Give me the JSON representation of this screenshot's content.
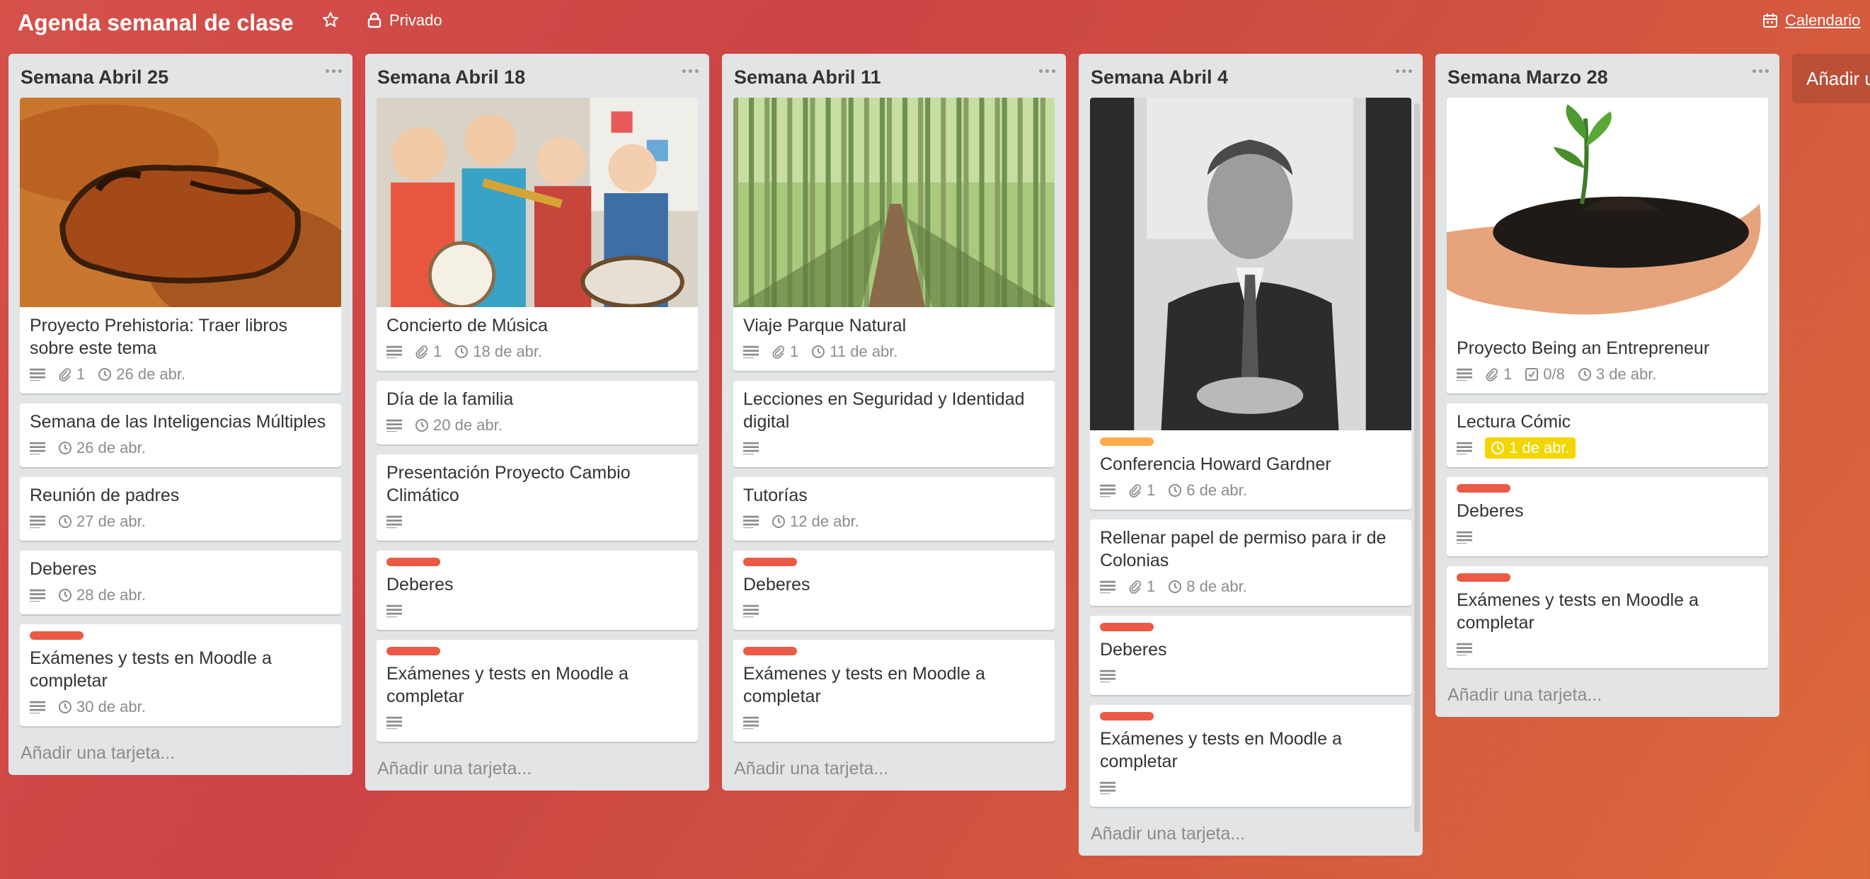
{
  "board": {
    "title": "Agenda semanal de clase",
    "visibility": "Privado",
    "calendar": "Calendario",
    "add_list": "Añadir u"
  },
  "colors": {
    "background": "#cb4445",
    "label_red": "#eb5a46",
    "label_orange": "#ffab4a",
    "due_yellow": "#f2d600"
  },
  "lists": [
    {
      "title": "Semana Abril 25",
      "add_card": "Añadir una tarjeta...",
      "cards": [
        {
          "cover": "cave-painting-bison",
          "title": "Proyecto Prehistoria: Traer libros sobre este tema",
          "attachments": "1",
          "due": "26 de abr."
        },
        {
          "title": "Semana de las Inteligencias Múltiples",
          "due": "26 de abr."
        },
        {
          "title": "Reunión de padres",
          "due": "27 de abr."
        },
        {
          "title": "Deberes",
          "due": "28 de abr."
        },
        {
          "label": "red",
          "title": "Exámenes y tests en Moodle a completar",
          "due": "30 de abr."
        }
      ]
    },
    {
      "title": "Semana Abril 18",
      "add_card": "Añadir una tarjeta...",
      "cards": [
        {
          "cover": "children-music-band",
          "title": "Concierto de Música",
          "attachments": "1",
          "due": "18 de abr."
        },
        {
          "title": "Día de la familia",
          "due": "20 de abr."
        },
        {
          "title": "Presentación Proyecto Cambio Climático"
        },
        {
          "label": "red",
          "title": "Deberes"
        },
        {
          "label": "red",
          "title": "Exámenes y tests en Moodle a completar"
        }
      ]
    },
    {
      "title": "Semana Abril 11",
      "add_card": "Añadir una tarjeta...",
      "cards": [
        {
          "cover": "bamboo-forest-path",
          "title": "Viaje Parque Natural",
          "attachments": "1",
          "due": "11 de abr."
        },
        {
          "title": "Lecciones en Seguridad y Identidad digital"
        },
        {
          "title": "Tutorías",
          "due": "12 de abr."
        },
        {
          "label": "red",
          "title": "Deberes"
        },
        {
          "label": "red",
          "title": "Exámenes y tests en Moodle a completar"
        }
      ]
    },
    {
      "title": "Semana Abril 4",
      "add_card": "Añadir una tarjeta...",
      "cards": [
        {
          "cover": "portrait-photo",
          "label": "orange",
          "title": "Conferencia Howard Gardner",
          "attachments": "1",
          "due": "6 de abr."
        },
        {
          "title": "Rellenar papel de permiso para ir de Colonias",
          "attachments": "1",
          "due": "8 de abr."
        },
        {
          "label": "red",
          "title": "Deberes"
        },
        {
          "label": "red",
          "title": "Exámenes y tests en Moodle a completar"
        }
      ]
    },
    {
      "title": "Semana Marzo 28",
      "add_card": "Añadir una tarjeta...",
      "cards": [
        {
          "cover": "hand-with-sprout",
          "title": "Proyecto Being an Entrepreneur",
          "attachments": "1",
          "checklist": "0/8",
          "due": "3 de abr."
        },
        {
          "title": "Lectura Cómic",
          "due": "1 de abr.",
          "due_highlight": "yellow"
        },
        {
          "label": "red",
          "title": "Deberes"
        },
        {
          "label": "red",
          "title": "Exámenes y tests en Moodle a completar"
        }
      ]
    }
  ]
}
